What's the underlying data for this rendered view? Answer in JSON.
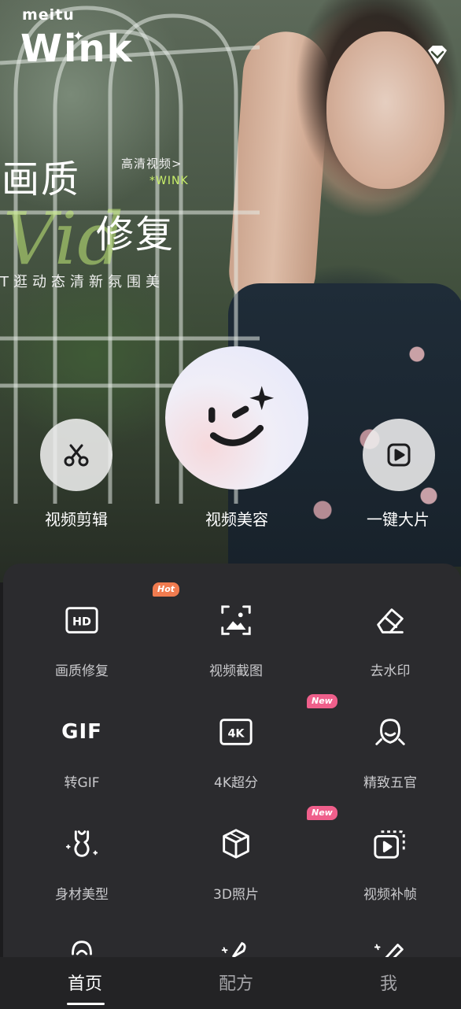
{
  "brand": {
    "small": "meitu",
    "big": "Wink"
  },
  "hero": {
    "title_line1": "画质",
    "title_line2": "修复",
    "script_text": "Vid",
    "small_text": "高清视频>",
    "small_text2": "*WINK",
    "subtitle": "T逛动态清新氛围美"
  },
  "quick_actions": [
    {
      "label": "视频剪辑",
      "icon": "scissors-icon"
    },
    {
      "label": "视频美容",
      "icon": "wink-face-icon"
    },
    {
      "label": "一键大片",
      "icon": "play-icon"
    }
  ],
  "tools": [
    {
      "label": "画质修复",
      "icon": "hd-icon",
      "badge": "Hot"
    },
    {
      "label": "视频截图",
      "icon": "screenshot-frame-icon",
      "badge": ""
    },
    {
      "label": "去水印",
      "icon": "eraser-icon",
      "badge": ""
    },
    {
      "label": "转GIF",
      "icon": "gif-icon",
      "icon_text": "GIF",
      "badge": ""
    },
    {
      "label": "4K超分",
      "icon": "4k-icon",
      "badge": "New"
    },
    {
      "label": "精致五官",
      "icon": "face-contour-icon",
      "badge": ""
    },
    {
      "label": "身材美型",
      "icon": "body-shape-icon",
      "badge": ""
    },
    {
      "label": "3D照片",
      "icon": "cube-3d-icon",
      "badge": "New"
    },
    {
      "label": "视频补帧",
      "icon": "frame-interp-icon",
      "badge": ""
    }
  ],
  "bottom_nav": [
    {
      "label": "首页",
      "active": true
    },
    {
      "label": "配方",
      "active": false
    },
    {
      "label": "我",
      "active": false
    }
  ],
  "colors": {
    "panel_bg": "#2b2b2e",
    "hot_badge": "#f07b4f",
    "new_badge": "#ef5f8b",
    "accent_green": "#c9ef6a"
  }
}
